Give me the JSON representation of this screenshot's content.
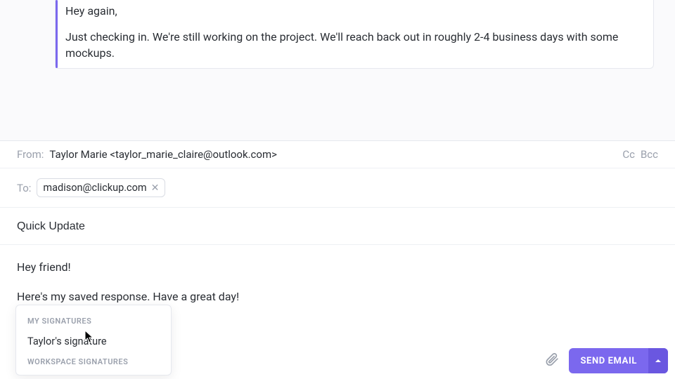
{
  "quoted": {
    "greeting": "Hey again,",
    "body": "Just checking in. We're still working on the project. We'll reach back out in roughly 2-4 business days with some mockups."
  },
  "compose": {
    "from_label": "From:",
    "from_value": "Taylor Marie <taylor_marie_claire@outlook.com>",
    "cc_label": "Cc",
    "bcc_label": "Bcc",
    "to_label": "To:",
    "to_chip": "madison@clickup.com",
    "subject": "Quick Update",
    "body_line1": "Hey friend!",
    "body_line2": "Here's my saved response. Have a great day!"
  },
  "signature_popup": {
    "section_my": "MY SIGNATURES",
    "item_taylor": "Taylor's signature",
    "section_workspace": "WORKSPACE SIGNATURES"
  },
  "toolbar": {
    "send_label": "SEND EMAIL"
  }
}
